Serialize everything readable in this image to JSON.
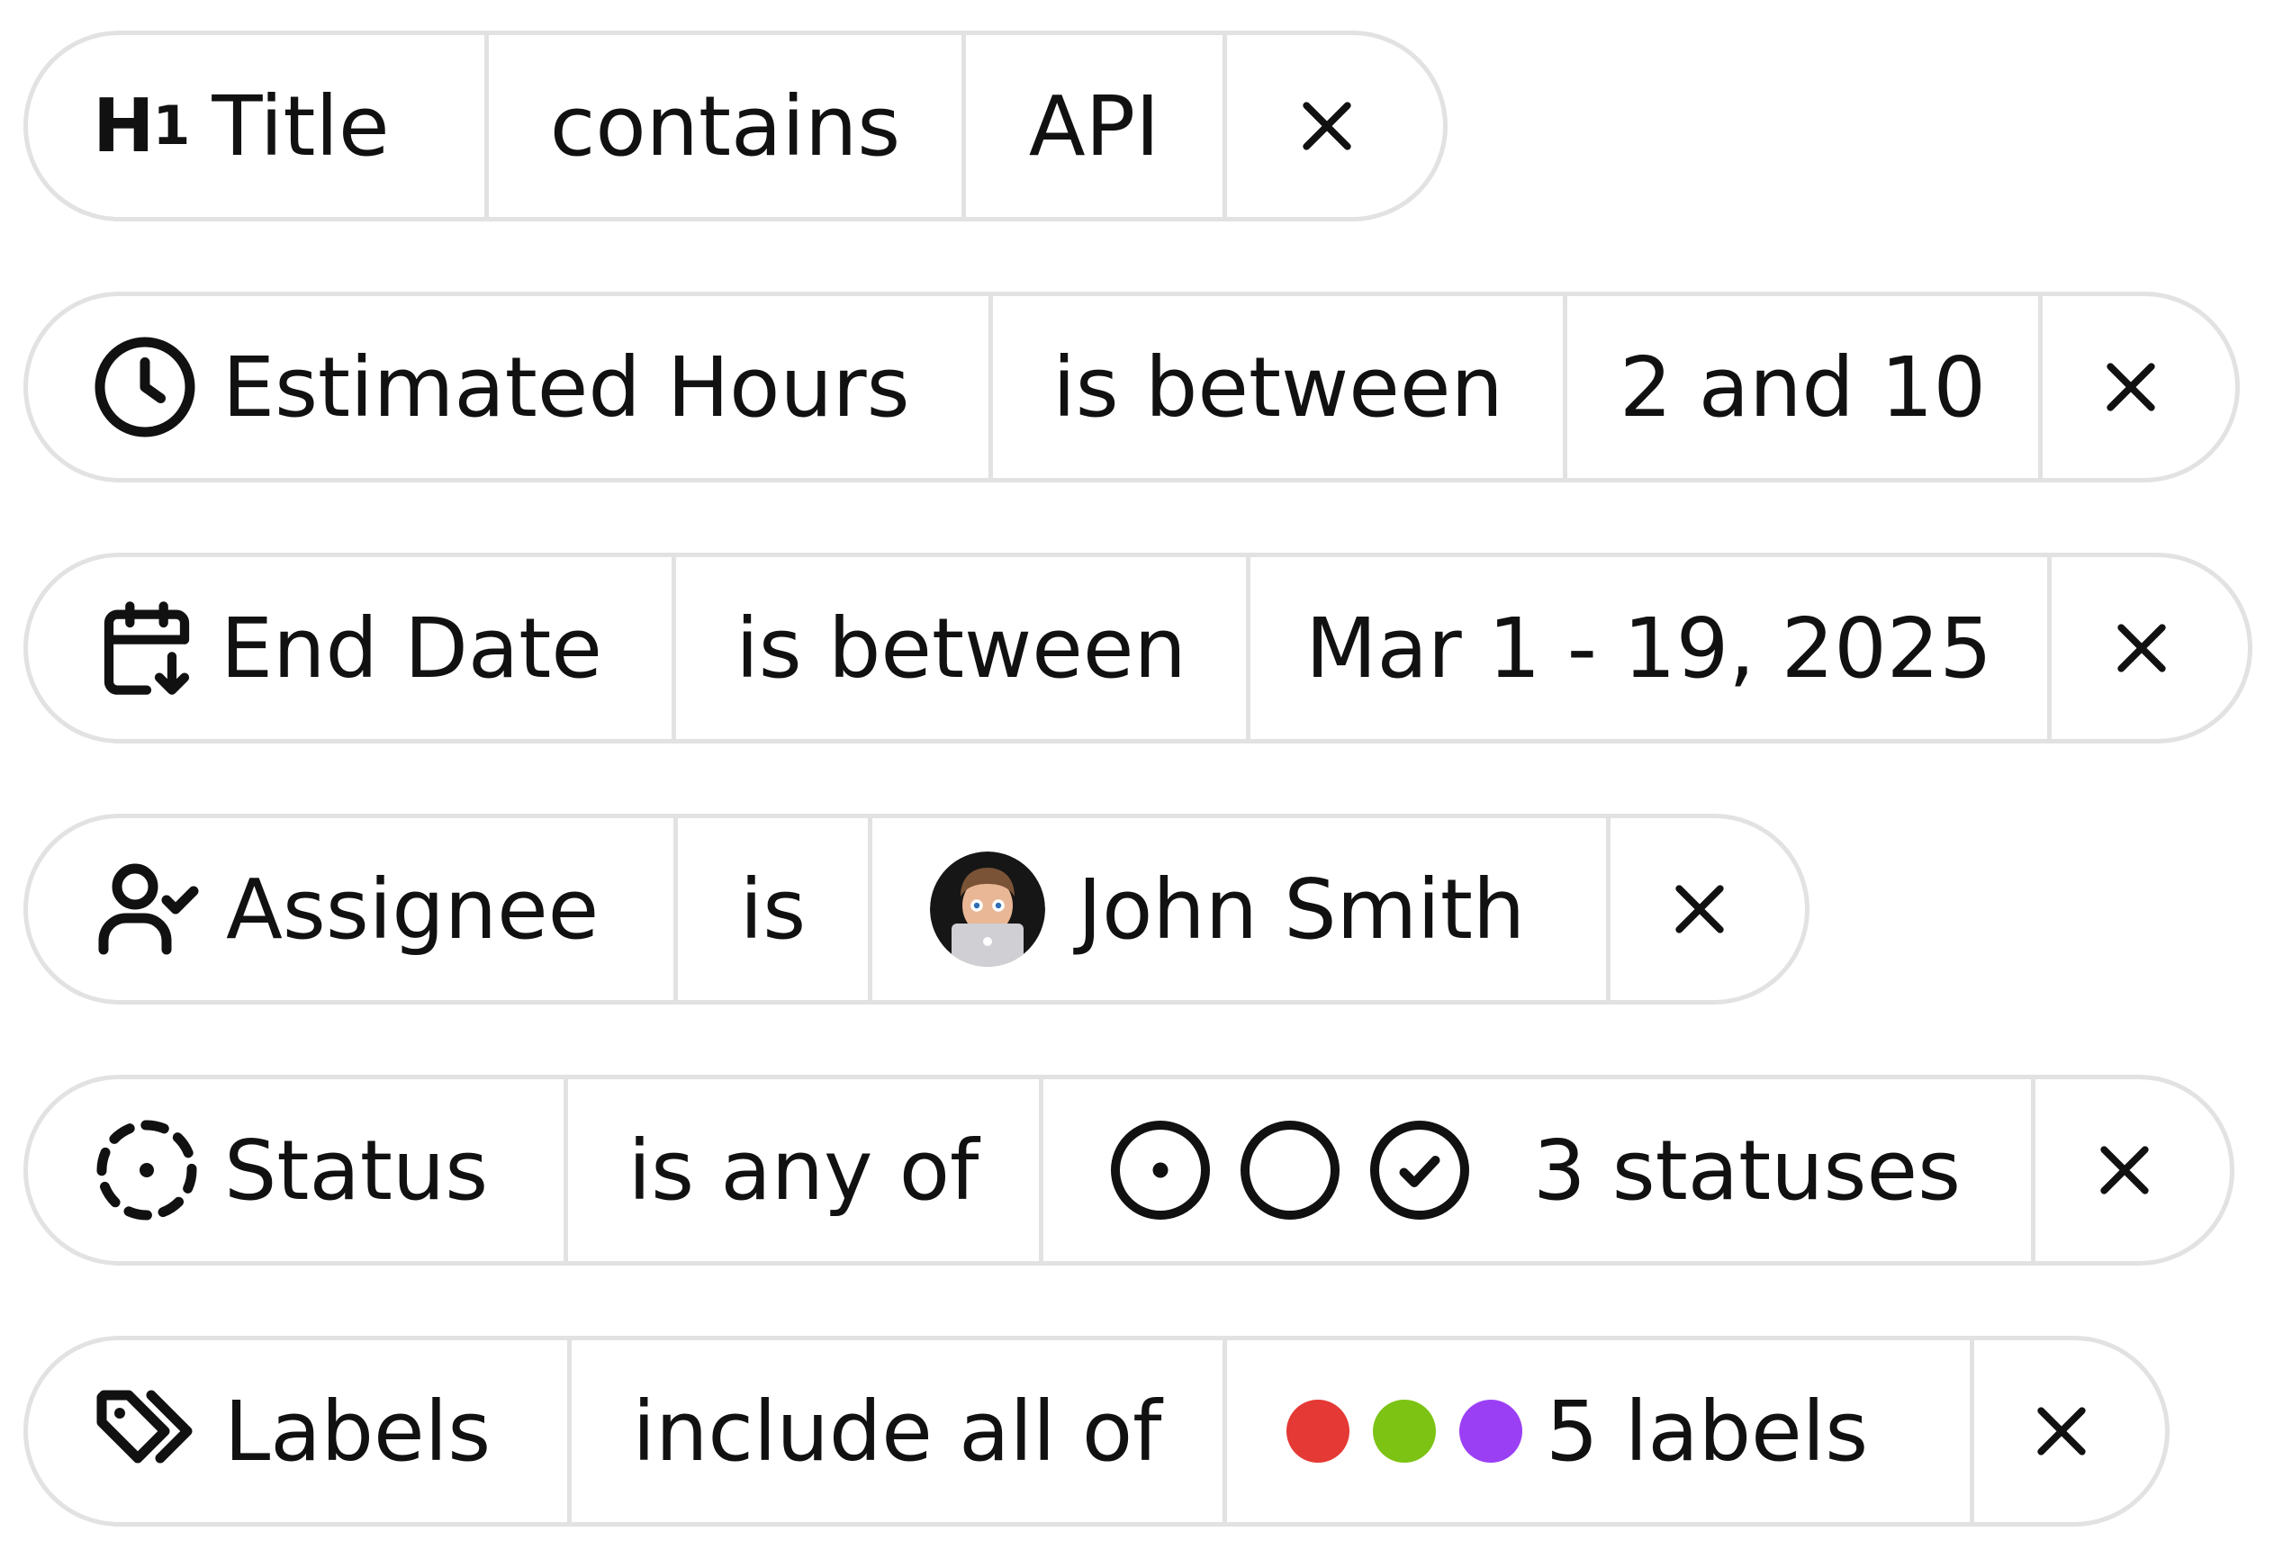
{
  "filters": [
    {
      "field": "Title",
      "field_icon": "heading-h1-icon",
      "operator": "contains",
      "value": "API"
    },
    {
      "field": "Estimated Hours",
      "field_icon": "clock-icon",
      "operator": "is between",
      "value": "2 and 10"
    },
    {
      "field": "End Date",
      "field_icon": "calendar-arrow-down-icon",
      "operator": "is between",
      "value": "Mar 1 - 19, 2025"
    },
    {
      "field": "Assignee",
      "field_icon": "user-check-icon",
      "operator": "is",
      "value": "John Smith",
      "value_icon": "avatar"
    },
    {
      "field": "Status",
      "field_icon": "dashed-circle-dot-icon",
      "operator": "is any of",
      "value": "3 statuses",
      "value_icons": [
        "circle-dot-icon",
        "circle-icon",
        "circle-check-icon"
      ]
    },
    {
      "field": "Labels",
      "field_icon": "tags-icon",
      "operator": "include all of",
      "value": "5 labels",
      "label_colors": [
        "#e53935",
        "#7cc314",
        "#9b3ff5"
      ]
    }
  ],
  "h1_glyph": {
    "h": "H",
    "sub": "1"
  },
  "remove_icon": "close-icon"
}
